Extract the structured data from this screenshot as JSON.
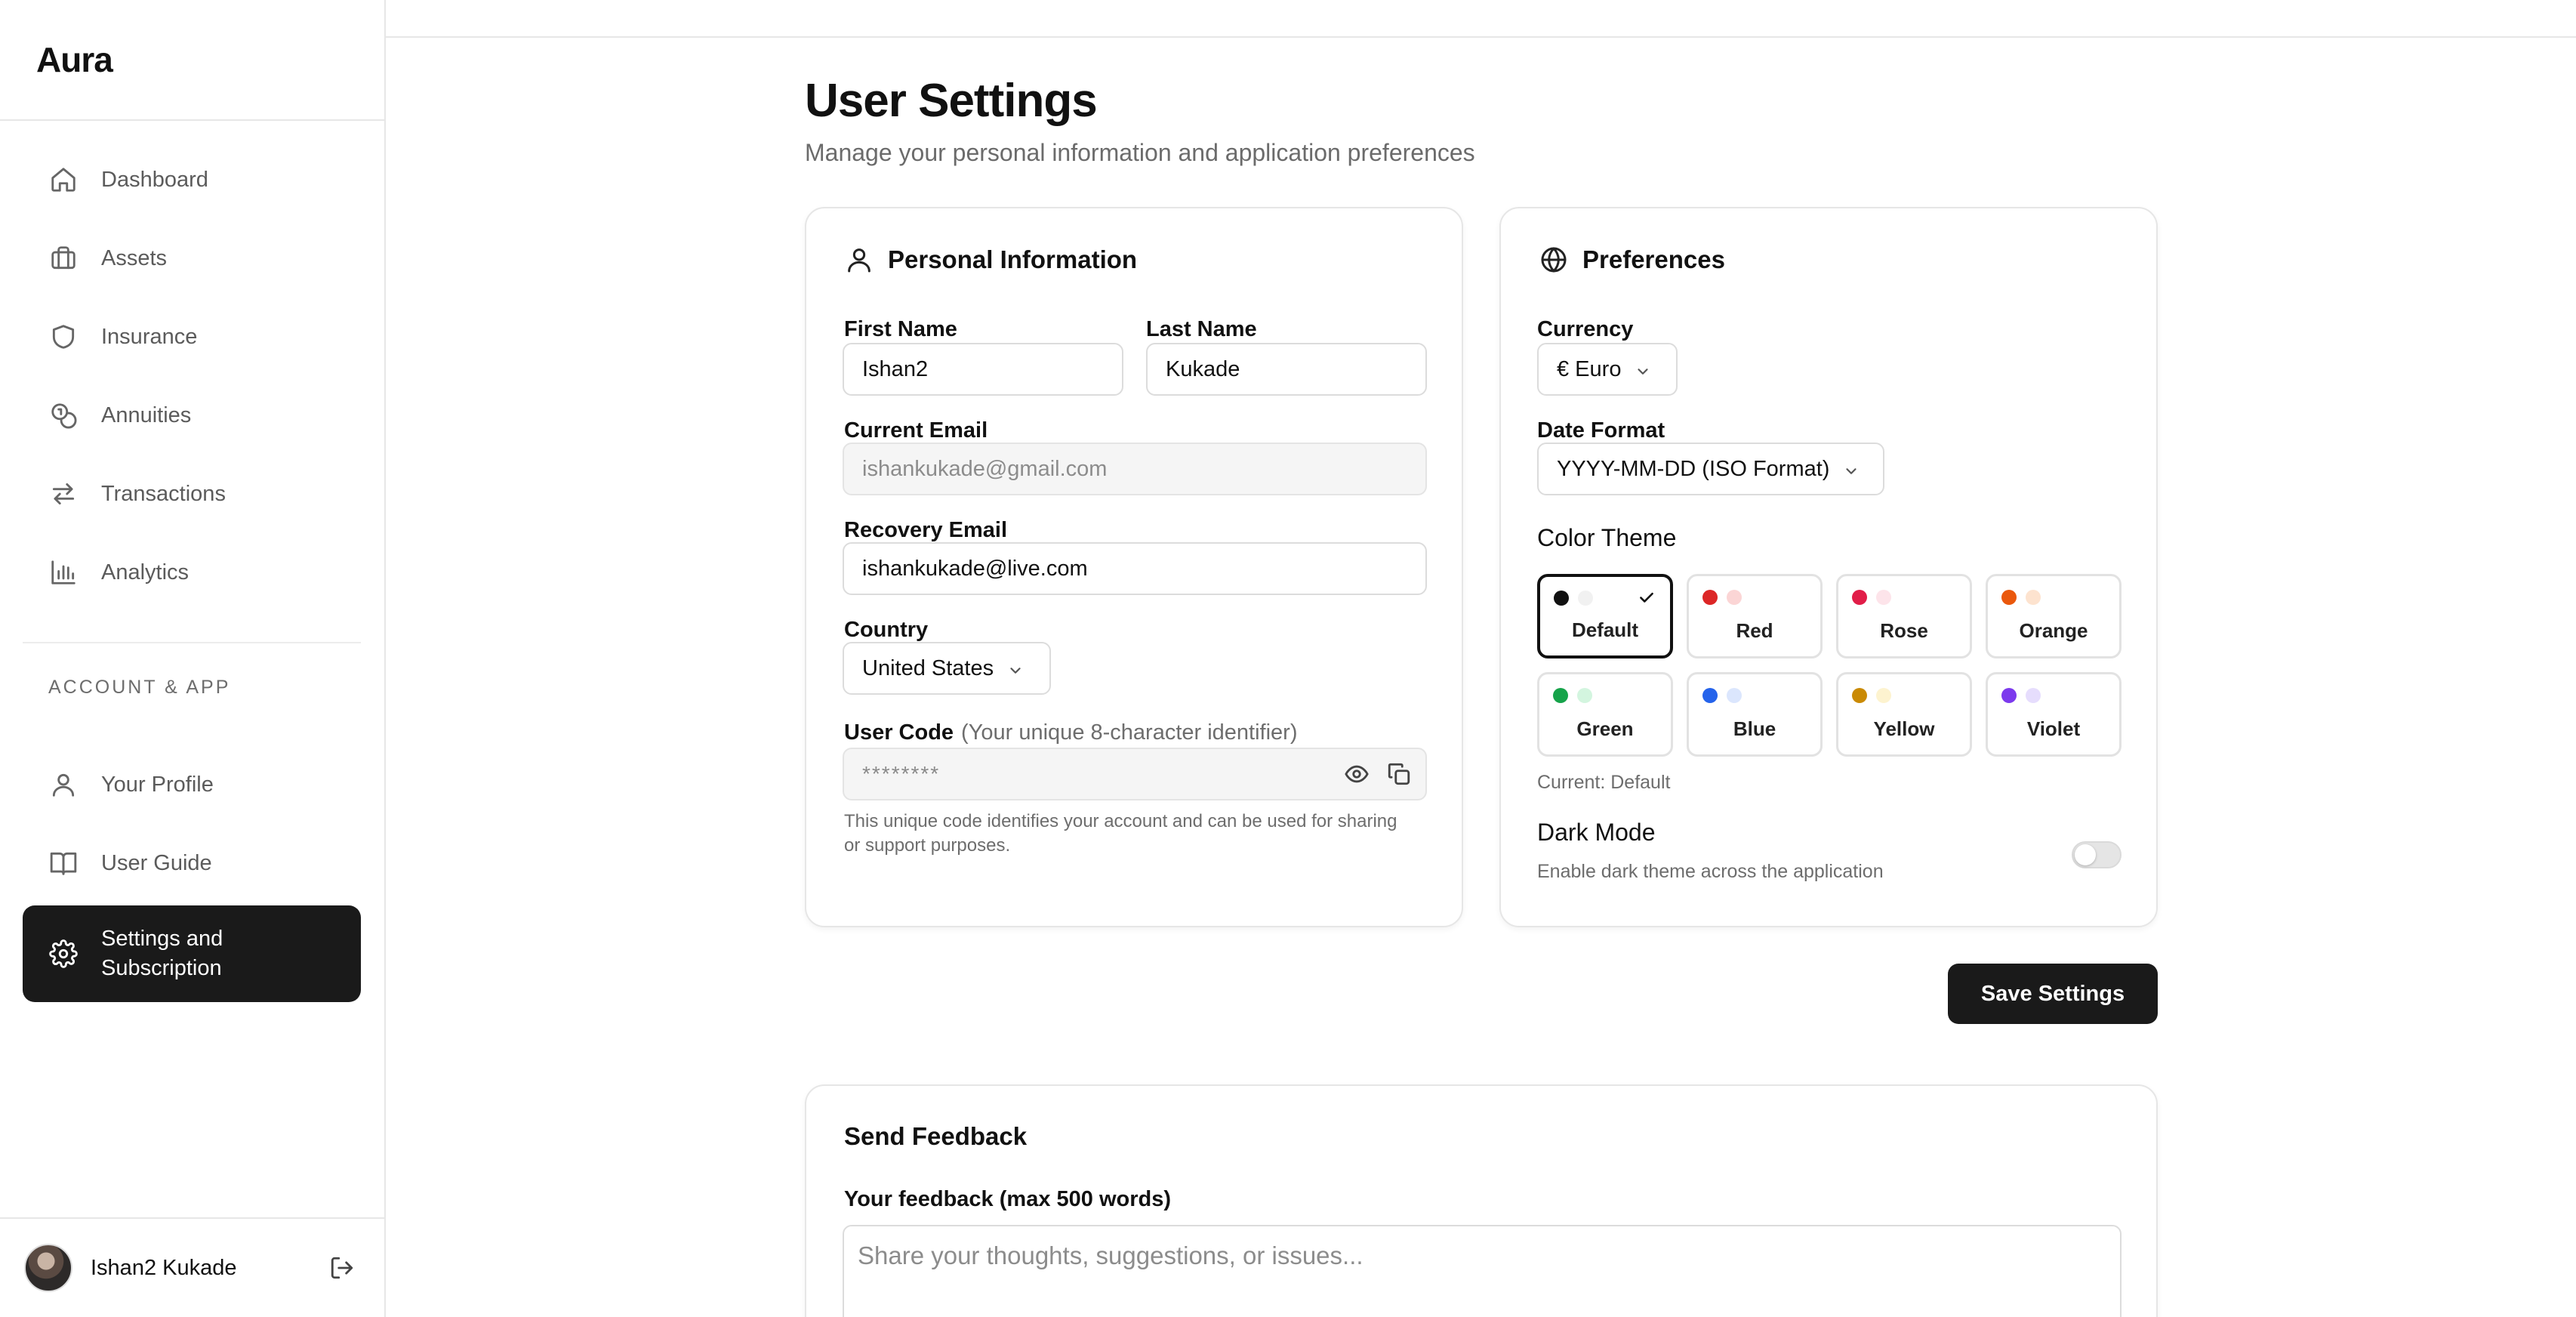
{
  "app": {
    "brand": "Aura"
  },
  "sidebar": {
    "items": [
      {
        "label": "Dashboard",
        "icon": "home-icon"
      },
      {
        "label": "Assets",
        "icon": "briefcase-icon"
      },
      {
        "label": "Insurance",
        "icon": "shield-icon"
      },
      {
        "label": "Annuities",
        "icon": "coins-icon"
      },
      {
        "label": "Transactions",
        "icon": "arrows-swap-icon"
      },
      {
        "label": "Analytics",
        "icon": "bar-chart-icon"
      }
    ],
    "section_label": "ACCOUNT & APP",
    "account_items": [
      {
        "label": "Your Profile",
        "icon": "user-icon"
      },
      {
        "label": "User Guide",
        "icon": "book-icon"
      },
      {
        "label": "Settings and Subscription",
        "icon": "gear-icon",
        "active": true
      }
    ],
    "user": {
      "name": "Ishan2 Kukade"
    }
  },
  "page": {
    "title": "User Settings",
    "subtitle": "Manage your personal information and application preferences"
  },
  "personal": {
    "heading": "Personal Information",
    "first_name_label": "First Name",
    "first_name": "Ishan2",
    "last_name_label": "Last Name",
    "last_name": "Kukade",
    "current_email_label": "Current Email",
    "current_email": "ishankukade@gmail.com",
    "recovery_email_label": "Recovery Email",
    "recovery_email": "ishankukade@live.com",
    "country_label": "Country",
    "country": "United States",
    "user_code_label": "User Code",
    "user_code_hint": "(Your unique 8-character identifier)",
    "user_code_masked": "********",
    "user_code_help": "This unique code identifies your account and can be used for sharing or support purposes."
  },
  "preferences": {
    "heading": "Preferences",
    "currency_label": "Currency",
    "currency": "€ Euro",
    "date_format_label": "Date Format",
    "date_format": "YYYY-MM-DD (ISO Format)",
    "color_theme_label": "Color Theme",
    "themes": [
      {
        "name": "Default",
        "primary": "#111111",
        "secondary": "#f1f1f1",
        "selected": true
      },
      {
        "name": "Red",
        "primary": "#dc2626",
        "secondary": "#fbd5d5",
        "selected": false
      },
      {
        "name": "Rose",
        "primary": "#e11d48",
        "secondary": "#fde4ea",
        "selected": false
      },
      {
        "name": "Orange",
        "primary": "#ea580c",
        "secondary": "#fde3cf",
        "selected": false
      },
      {
        "name": "Green",
        "primary": "#16a34a",
        "secondary": "#d3f5df",
        "selected": false
      },
      {
        "name": "Blue",
        "primary": "#2563eb",
        "secondary": "#dbe6fd",
        "selected": false
      },
      {
        "name": "Yellow",
        "primary": "#ca8a04",
        "secondary": "#fdf3cf",
        "selected": false
      },
      {
        "name": "Violet",
        "primary": "#7c3aed",
        "secondary": "#e6ddfd",
        "selected": false
      }
    ],
    "current_theme": "Current: Default",
    "dark_mode_label": "Dark Mode",
    "dark_mode_desc": "Enable dark theme across the application",
    "dark_mode_on": false
  },
  "actions": {
    "save_label": "Save Settings"
  },
  "feedback": {
    "heading": "Send Feedback",
    "label": "Your feedback (max 500 words)",
    "placeholder": "Share your thoughts, suggestions, or issues..."
  }
}
